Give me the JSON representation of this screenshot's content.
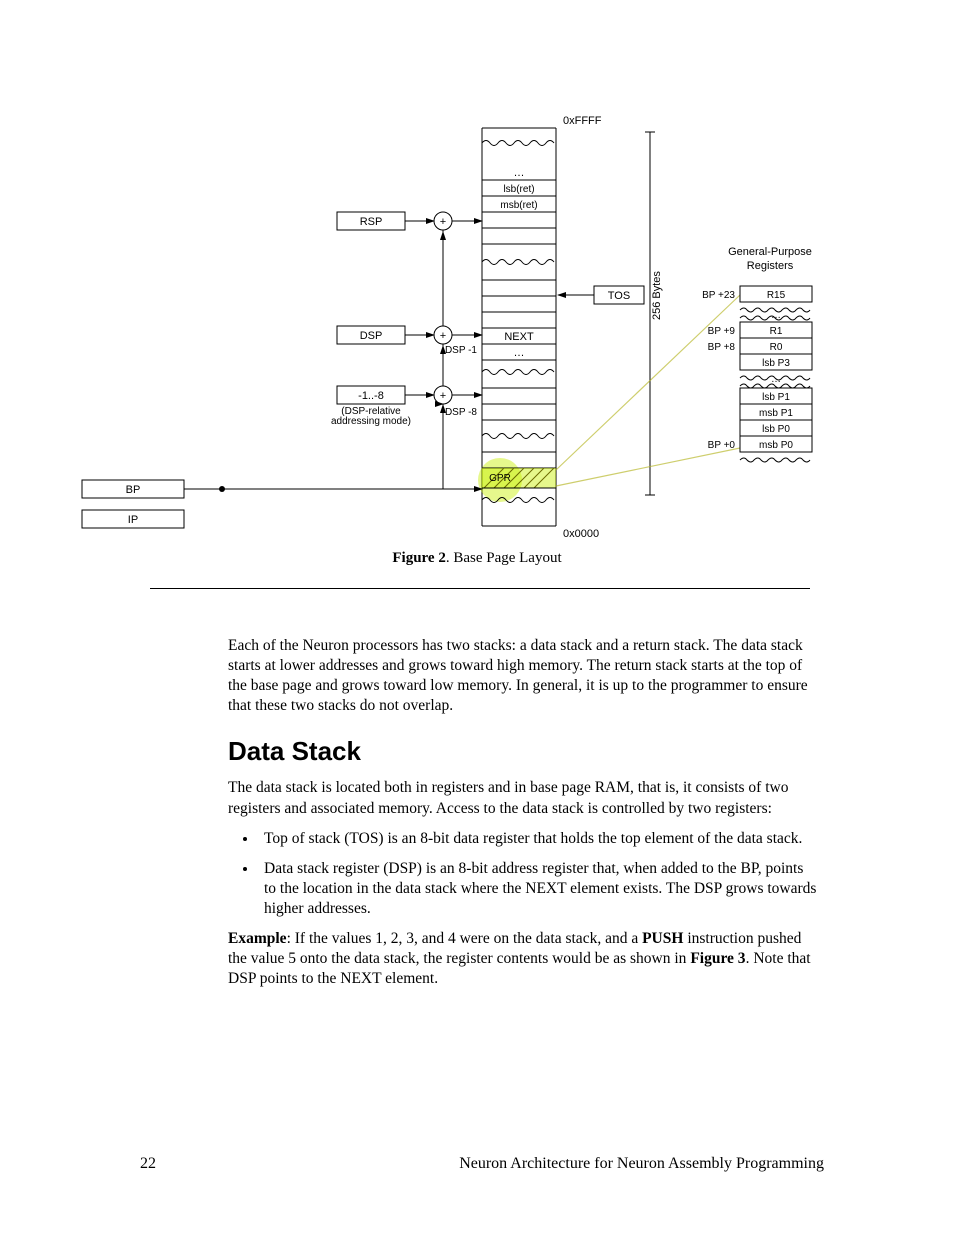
{
  "figure": {
    "caption_prefix": "Figure 2",
    "caption_text": ". Base Page Layout",
    "addr_top": "0xFFFF",
    "addr_bottom": "0x0000",
    "bytes_label": "256 Bytes",
    "registers": {
      "RSP": "RSP",
      "DSP": "DSP",
      "range": "-1..-8",
      "mode_line1": "(DSP-relative",
      "mode_line2": "addressing mode)",
      "BP": "BP",
      "IP": "IP"
    },
    "stack_cells": {
      "ellipsis1": "…",
      "lsb_ret": "lsb(ret)",
      "msb_ret": "msb(ret)",
      "TOS": "TOS",
      "NEXT": "NEXT",
      "ellipsis2": "…",
      "GPR": "GPR"
    },
    "dsp_m1": "DSP -1",
    "dsp_m8": "DSP -8",
    "gpr_title": "General-Purpose",
    "gpr_title2": "Registers",
    "bp_off": {
      "bp23": "BP +23",
      "bp9": "BP +9",
      "bp8": "BP +8",
      "bp0": "BP +0"
    },
    "gpr_cells": {
      "r15": "R15",
      "ell": "…",
      "r1": "R1",
      "r0": "R0",
      "lsbP3": "lsb P3",
      "ell2": "…",
      "lsbP1": "lsb P1",
      "msbP1": "msb P1",
      "lsbP0": "lsb P0",
      "msbP0": "msb P0"
    }
  },
  "text": {
    "p1": "Each of the Neuron processors has two stacks:  a data stack and a return stack. The data stack starts at lower addresses and grows toward high memory.  The return stack starts at the top of the base page and grows toward low memory.  In general, it is up to the programmer to ensure that these two stacks do not overlap.",
    "h2": "Data Stack",
    "p2": "The data stack is located both in registers and in base page RAM, that is, it consists of two registers and associated memory.  Access to the data stack is controlled by two registers:",
    "li1": "Top of stack (TOS) is an 8-bit data register that holds the top element of the data stack.",
    "li2": "Data stack register (DSP) is an 8-bit address register that, when added to the BP, points to the location in the data stack where the NEXT element exists.  The DSP grows towards higher addresses.",
    "ex_label": "Example",
    "ex_body": ":  If the values 1, 2, 3, and 4 were on the data stack, and a ",
    "push": "PUSH",
    "ex_body2": " instruction pushed the value 5 onto the data stack, the register contents would be as shown in ",
    "fig3": "Figure 3",
    "ex_body3": ".  Note that DSP points to the NEXT element."
  },
  "footer": {
    "page": "22",
    "title": "Neuron Architecture for Neuron Assembly Programming"
  }
}
